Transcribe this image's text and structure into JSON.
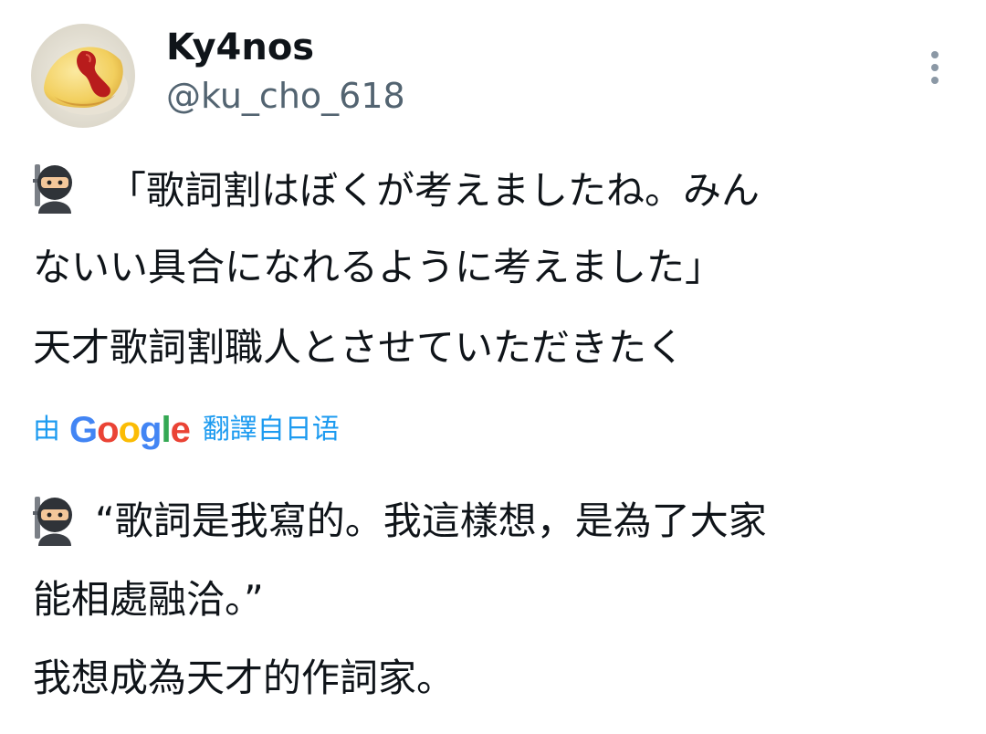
{
  "author": {
    "display_name": "Ky4nos",
    "handle": "@ku_cho_618",
    "avatar_icon": "omurice-avatar"
  },
  "menu": {
    "icon": "more-vertical-icon"
  },
  "original": {
    "emoji": "ninja-emoji",
    "lines": [
      "「歌詞割はぼくが考えましたね。みん",
      "ないい具合になれるように考えました」",
      "天才歌詞割職人とさせていただきたく"
    ]
  },
  "translation": {
    "by_label": "由",
    "provider_letters": [
      "G",
      "o",
      "o",
      "g",
      "l",
      "e"
    ],
    "from_label": "翻譯自日语",
    "emoji": "ninja-emoji",
    "lines": [
      "“歌詞是我寫的。我這樣想，是為了大家",
      "能相處融洽。”",
      "我想成為天才的作詞家。"
    ]
  },
  "colors": {
    "link": "#1d9bf0",
    "text": "#0f1419",
    "secondary": "#536471"
  }
}
